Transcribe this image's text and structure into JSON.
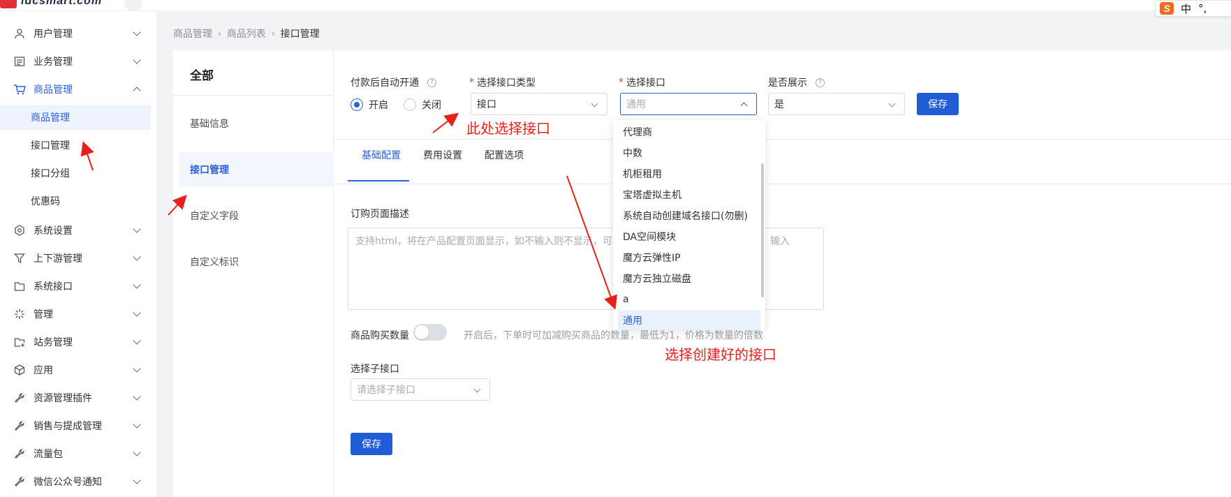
{
  "topbar": {
    "logo_text": "idcsmart.com"
  },
  "ime": {
    "logo": "S",
    "lang": "中",
    "punct": "°,"
  },
  "sidebar": {
    "items": [
      {
        "label": "用户管理",
        "icon": "user-icon"
      },
      {
        "label": "业务管理",
        "icon": "list-icon"
      },
      {
        "label": "商品管理",
        "icon": "cart-icon"
      },
      {
        "label": "系统设置",
        "icon": "gear-icon"
      },
      {
        "label": "上下游管理",
        "icon": "filter-icon"
      },
      {
        "label": "系统接口",
        "icon": "folder-icon"
      },
      {
        "label": "管理",
        "icon": "sparkle-icon"
      },
      {
        "label": "站务管理",
        "icon": "folder-plus-icon"
      },
      {
        "label": "应用",
        "icon": "cube-icon"
      },
      {
        "label": "资源管理插件",
        "icon": "wrench-icon"
      },
      {
        "label": "销售与提成管理",
        "icon": "wrench-icon"
      },
      {
        "label": "流量包",
        "icon": "wrench-icon"
      },
      {
        "label": "微信公众号通知",
        "icon": "wrench-icon"
      }
    ],
    "sub_items": [
      "商品管理",
      "接口管理",
      "接口分组",
      "优惠码"
    ]
  },
  "breadcrumb": {
    "items": [
      "商品管理",
      "商品列表",
      "接口管理"
    ],
    "sep": "›"
  },
  "leftmenu": {
    "title": "全部",
    "items": [
      "基础信息",
      "接口管理",
      "自定义字段",
      "自定义标识"
    ]
  },
  "form": {
    "auto_open_label": "付款后自动开通",
    "radio_on": "开启",
    "radio_off": "关闭",
    "iface_type_label": "选择接口类型",
    "iface_type_value": "接口",
    "iface_label": "选择接口",
    "iface_placeholder": "通用",
    "display_label": "是否展示",
    "display_value": "是",
    "save_label": "保存",
    "required_mark": "*",
    "help_mark": "?"
  },
  "tabs": [
    "基础配置",
    "费用设置",
    "配置选项"
  ],
  "config": {
    "desc_label": "订购页面描述",
    "desc_placeholder_left": "支持html，将在产品配置页面显示，如不输入则不显示，可调",
    "desc_placeholder_right": "输入",
    "qty_label": "商品购买数量",
    "qty_hint": "开启后，下单时可加减购买商品的数量，最低为1，价格为数量的倍数",
    "sub_iface_label": "选择子接口",
    "sub_iface_placeholder": "请选择子接口",
    "save_label": "保存"
  },
  "dropdown": {
    "options": [
      "代理商",
      "中数",
      "机柜租用",
      "宝塔虚拟主机",
      "系统自动创建域名接口(勿删)",
      "DA空间模块",
      "魔方云弹性IP",
      "魔方云独立磁盘",
      "a",
      "通用"
    ],
    "selected": "通用"
  },
  "annotations": {
    "select_here": "此处选择接口",
    "select_created": "选择创建好的接口"
  },
  "colors": {
    "accent": "#2a60d8",
    "annotation": "#e8201b",
    "button": "#1f5cd6"
  }
}
